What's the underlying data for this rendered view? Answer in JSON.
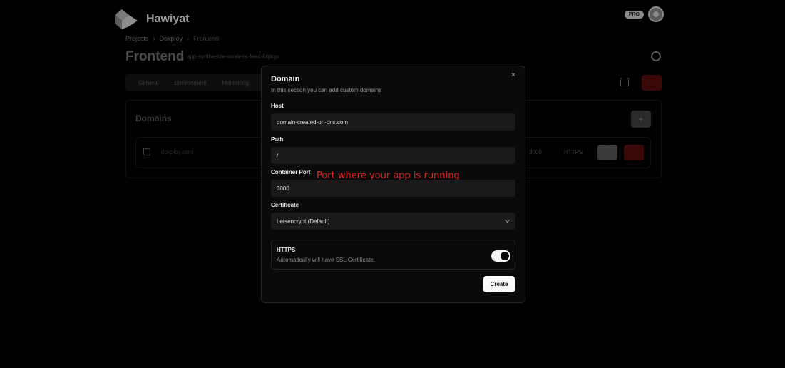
{
  "app": {
    "brand": "Hawiyat",
    "pro_badge": "PRO"
  },
  "breadcrumb": [
    "Projects",
    "Dokploy",
    "Frontend"
  ],
  "breadcrumb_separator": "›",
  "page": {
    "title": "Frontend",
    "slug": "app-synthesize-wireless-feed-8qtkgx"
  },
  "tabs": [
    "General",
    "Environment",
    "Monitoring"
  ],
  "domains_section": {
    "title": "Domains",
    "add_label": "+",
    "row": {
      "host": "dokploy.com",
      "port": "3000",
      "protocol": "HTTPS"
    }
  },
  "modal": {
    "title": "Domain",
    "subtitle": "In this section you can add custom domains",
    "close_label": "×",
    "host_label": "Host",
    "host_value": "domain-created-on-dns.com",
    "path_label": "Path",
    "path_value": "/",
    "port_label": "Container Port",
    "port_value": "3000",
    "cert_label": "Certificate",
    "cert_value": "Letsencrypt (Default)",
    "https_title": "HTTPS",
    "https_desc": "Automatically will have SSL Certificate.",
    "https_enabled": true,
    "create_label": "Create"
  },
  "annotation": "Port where your app is running",
  "colors": {
    "danger": "#3a0808",
    "annotation": "#e02424",
    "modal_bg": "#0a0a0a",
    "input_bg": "#1a1a1a"
  }
}
